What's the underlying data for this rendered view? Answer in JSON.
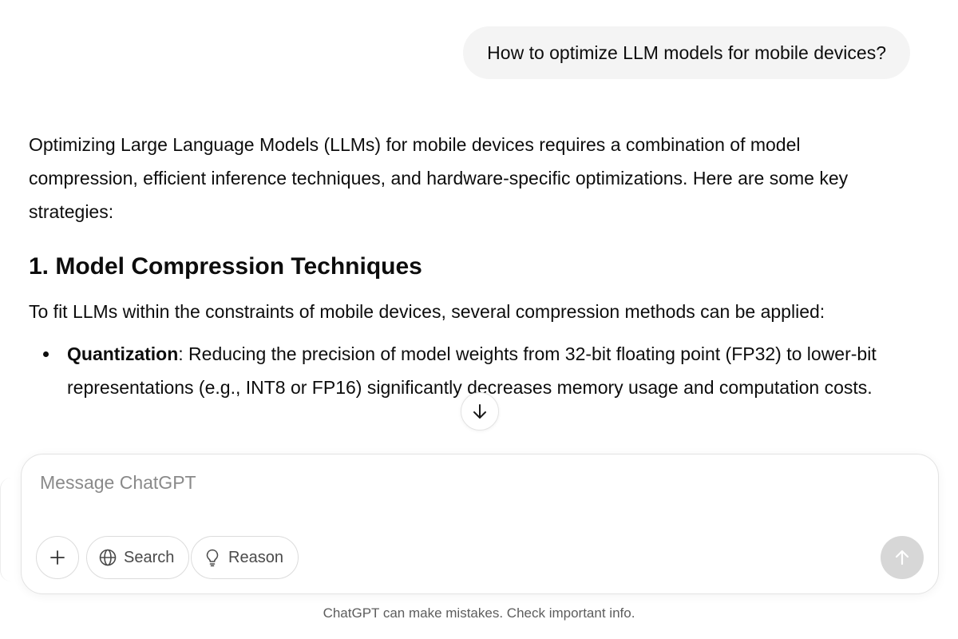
{
  "conversation": {
    "user_message": "How to optimize LLM models for mobile devices?",
    "response": {
      "intro": "Optimizing Large Language Models (LLMs) for mobile devices requires a combination of model compression, efficient inference techniques, and hardware-specific optimizations. Here are some key strategies:",
      "section_heading": "1. Model Compression Techniques",
      "section_intro": "To fit LLMs within the constraints of mobile devices, several compression methods can be applied:",
      "bullets": [
        {
          "term": "Quantization",
          "text": ": Reducing the precision of model weights from 32-bit floating point (FP32) to lower-bit representations (e.g., INT8 or FP16) significantly decreases memory usage and computation costs."
        }
      ]
    }
  },
  "composer": {
    "placeholder": "Message ChatGPT",
    "search_label": "Search",
    "reason_label": "Reason"
  },
  "footer": {
    "disclaimer": "ChatGPT can make mistakes. Check important info."
  },
  "icons": {
    "plus": "plus-icon",
    "search": "globe-icon",
    "reason": "lightbulb-icon",
    "send": "arrow-up-icon",
    "scroll": "arrow-down-icon"
  }
}
